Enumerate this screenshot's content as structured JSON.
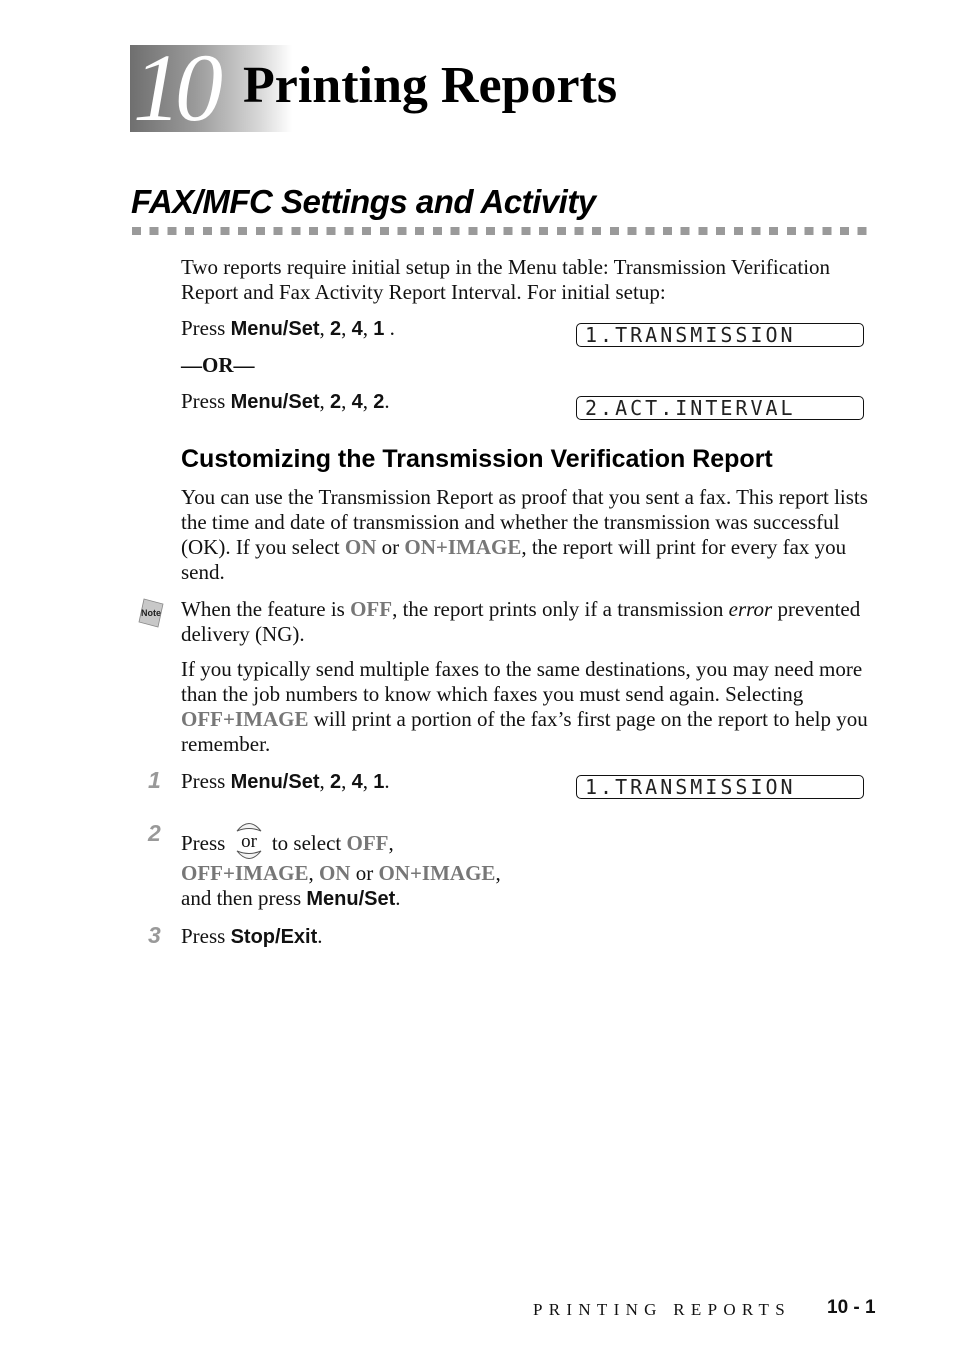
{
  "chapter": {
    "number": "10",
    "title": "Printing Reports"
  },
  "section": {
    "title": "FAX/MFC Settings and Activity"
  },
  "intro": {
    "text": "Two reports require initial setup in the Menu table: Transmission Verification Report and Fax Activity Report Interval. For initial setup:",
    "press_1": {
      "prefix": "Press ",
      "key": "Menu/Set",
      "sep1": ", ",
      "d1": "2",
      "sep2": ", ",
      "d2": "4",
      "sep3": ", ",
      "d3": "1",
      "end": " ."
    },
    "or_label": "—OR—",
    "press_2": {
      "prefix": "Press ",
      "key": "Menu/Set",
      "sep1": ", ",
      "d1": "2",
      "sep2": ", ",
      "d2": "4",
      "sep3": ", ",
      "d3": "2",
      "end": "."
    },
    "lcd_1": "1.TRANSMISSION",
    "lcd_2": "2.ACT.INTERVAL"
  },
  "subsection": {
    "title": "Customizing the Transmission Verification Report",
    "para1": {
      "a": "You can use the Transmission Report as proof that you sent a fax. This report lists the time and date of transmission and whether the transmission was successful (OK). If you select ",
      "on": "ON",
      "b": " or ",
      "on_image": "ON+IMAGE",
      "c": ", the report will print for every fax you send."
    },
    "note": {
      "icon_label": "Note",
      "a": "When the feature is ",
      "off": "OFF",
      "b": ", the report prints only if a transmission ",
      "error": "error",
      "c": " prevented delivery (NG)."
    },
    "para2": {
      "a": "If you typically send multiple faxes to the same destinations, you may need more than the job numbers to know which faxes you must send again. Selecting ",
      "off_image": "OFF+IMAGE",
      "b": " will print a portion of the fax’s first page on the report to help you remember."
    }
  },
  "steps": [
    {
      "num": "1",
      "prefix": "Press ",
      "key": "Menu/Set",
      "sep1": ", ",
      "d1": "2",
      "sep2": ", ",
      "d2": "4",
      "sep3": ", ",
      "d3": "1",
      "end": ".",
      "lcd": "1.TRANSMISSION"
    },
    {
      "num": "2",
      "prefix": "Press ",
      "icon_text": "or",
      "after_icon": " to select ",
      "opt_off": "OFF",
      "comma1": ",",
      "opt_off_image": "OFF+IMAGE",
      "comma2": ", ",
      "opt_on": "ON",
      "or_word": " or ",
      "opt_on_image": "ON+IMAGE",
      "comma3": ",",
      "line3_a": "and then press ",
      "line3_key": "Menu/Set",
      "line3_end": "."
    },
    {
      "num": "3",
      "prefix": "Press ",
      "key": "Stop/Exit",
      "end": "."
    }
  ],
  "footer": {
    "running_head": "PRINTING REPORTS",
    "page": "10 - 1"
  }
}
